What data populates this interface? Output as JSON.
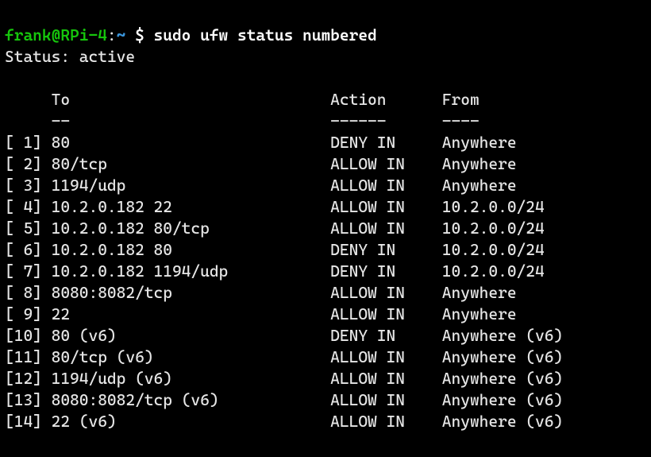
{
  "prompt": {
    "host": "frank@RPi-4",
    "colon": ":",
    "path": "~",
    "dollar": " $ ",
    "command": "sudo ufw status numbered"
  },
  "status_label": "Status: ",
  "status_value": "active",
  "headers": {
    "num": "    ",
    "to": "To",
    "action": "Action",
    "from": "From"
  },
  "dividers": {
    "num": "    ",
    "to": "--",
    "action": "------",
    "from": "----"
  },
  "rules": [
    {
      "num": "[ 1]",
      "to": "80",
      "action": "DENY IN",
      "from": "Anywhere"
    },
    {
      "num": "[ 2]",
      "to": "80/tcp",
      "action": "ALLOW IN",
      "from": "Anywhere"
    },
    {
      "num": "[ 3]",
      "to": "1194/udp",
      "action": "ALLOW IN",
      "from": "Anywhere"
    },
    {
      "num": "[ 4]",
      "to": "10.2.0.182 22",
      "action": "ALLOW IN",
      "from": "10.2.0.0/24"
    },
    {
      "num": "[ 5]",
      "to": "10.2.0.182 80/tcp",
      "action": "ALLOW IN",
      "from": "10.2.0.0/24"
    },
    {
      "num": "[ 6]",
      "to": "10.2.0.182 80",
      "action": "DENY IN",
      "from": "10.2.0.0/24"
    },
    {
      "num": "[ 7]",
      "to": "10.2.0.182 1194/udp",
      "action": "DENY IN",
      "from": "10.2.0.0/24"
    },
    {
      "num": "[ 8]",
      "to": "8080:8082/tcp",
      "action": "ALLOW IN",
      "from": "Anywhere"
    },
    {
      "num": "[ 9]",
      "to": "22",
      "action": "ALLOW IN",
      "from": "Anywhere"
    },
    {
      "num": "[10]",
      "to": "80 (v6)",
      "action": "DENY IN",
      "from": "Anywhere (v6)"
    },
    {
      "num": "[11]",
      "to": "80/tcp (v6)",
      "action": "ALLOW IN",
      "from": "Anywhere (v6)"
    },
    {
      "num": "[12]",
      "to": "1194/udp (v6)",
      "action": "ALLOW IN",
      "from": "Anywhere (v6)"
    },
    {
      "num": "[13]",
      "to": "8080:8082/tcp (v6)",
      "action": "ALLOW IN",
      "from": "Anywhere (v6)"
    },
    {
      "num": "[14]",
      "to": "22 (v6)",
      "action": "ALLOW IN",
      "from": "Anywhere (v6)"
    }
  ],
  "cols": {
    "num": 5,
    "to": 30,
    "action": 12
  }
}
